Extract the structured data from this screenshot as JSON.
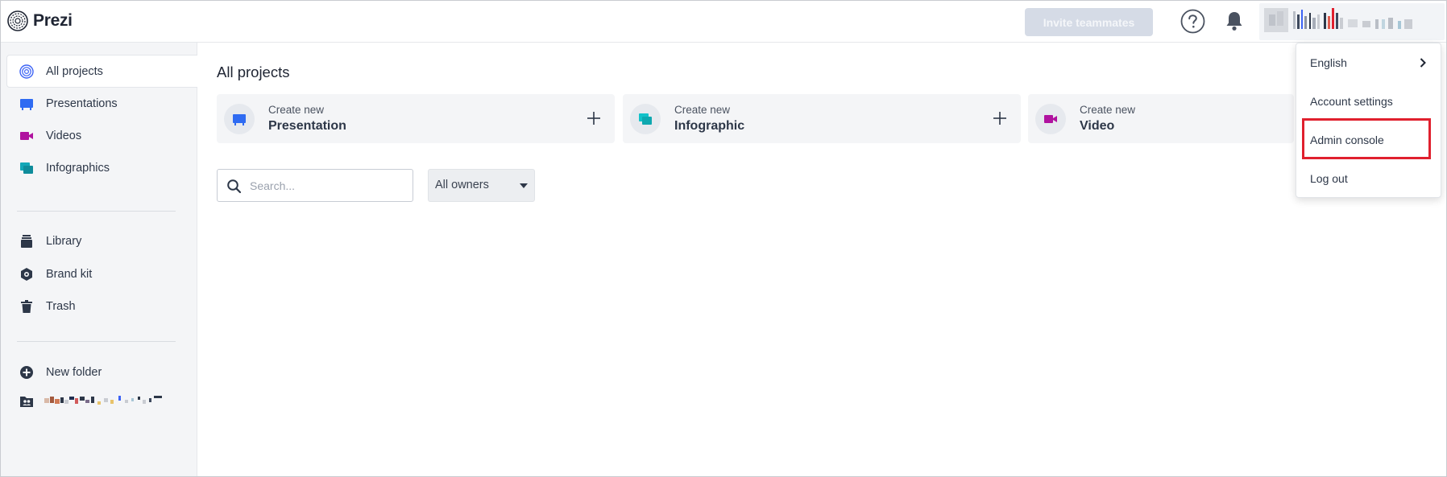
{
  "app": {
    "name": "Prezi"
  },
  "header": {
    "invite_label": "Invite teammates",
    "help_icon": "question-circle-icon",
    "notifications_icon": "bell-icon"
  },
  "sidebar": {
    "items": [
      {
        "label": "All projects",
        "icon": "prezi-swirl-icon",
        "color": "#3d63f5",
        "active": true
      },
      {
        "label": "Presentations",
        "icon": "presentation-icon",
        "color": "#2f6bf2"
      },
      {
        "label": "Videos",
        "icon": "video-camera-icon",
        "color": "#b0129f"
      },
      {
        "label": "Infographics",
        "icon": "infographic-icon",
        "color": "#12a7b8"
      },
      {
        "label": "Library",
        "icon": "library-icon",
        "color": "#2d3748"
      },
      {
        "label": "Brand kit",
        "icon": "brand-kit-icon",
        "color": "#2d3748"
      },
      {
        "label": "Trash",
        "icon": "trash-icon",
        "color": "#2d3748"
      },
      {
        "label": "New folder",
        "icon": "plus-circle-icon",
        "color": "#2d3748"
      }
    ],
    "shared_folder_icon": "shared-folder-icon"
  },
  "main": {
    "title": "All projects",
    "create_cards": [
      {
        "sub": "Create new",
        "title": "Presentation",
        "icon": "presentation-icon",
        "color": "#2f6bf2"
      },
      {
        "sub": "Create new",
        "title": "Infographic",
        "icon": "infographic-icon",
        "color": "#12c2c9"
      },
      {
        "sub": "Create new",
        "title": "Video",
        "icon": "video-camera-icon",
        "color": "#b0129f"
      }
    ],
    "search": {
      "placeholder": "Search...",
      "value": ""
    },
    "owner_filter": {
      "selected": "All owners"
    }
  },
  "account_menu": {
    "items": [
      {
        "label": "English",
        "has_submenu": true
      },
      {
        "label": "Account settings"
      },
      {
        "label": "Admin console",
        "highlighted": true
      },
      {
        "label": "Log out"
      }
    ],
    "highlight_color": "#e0202e"
  }
}
